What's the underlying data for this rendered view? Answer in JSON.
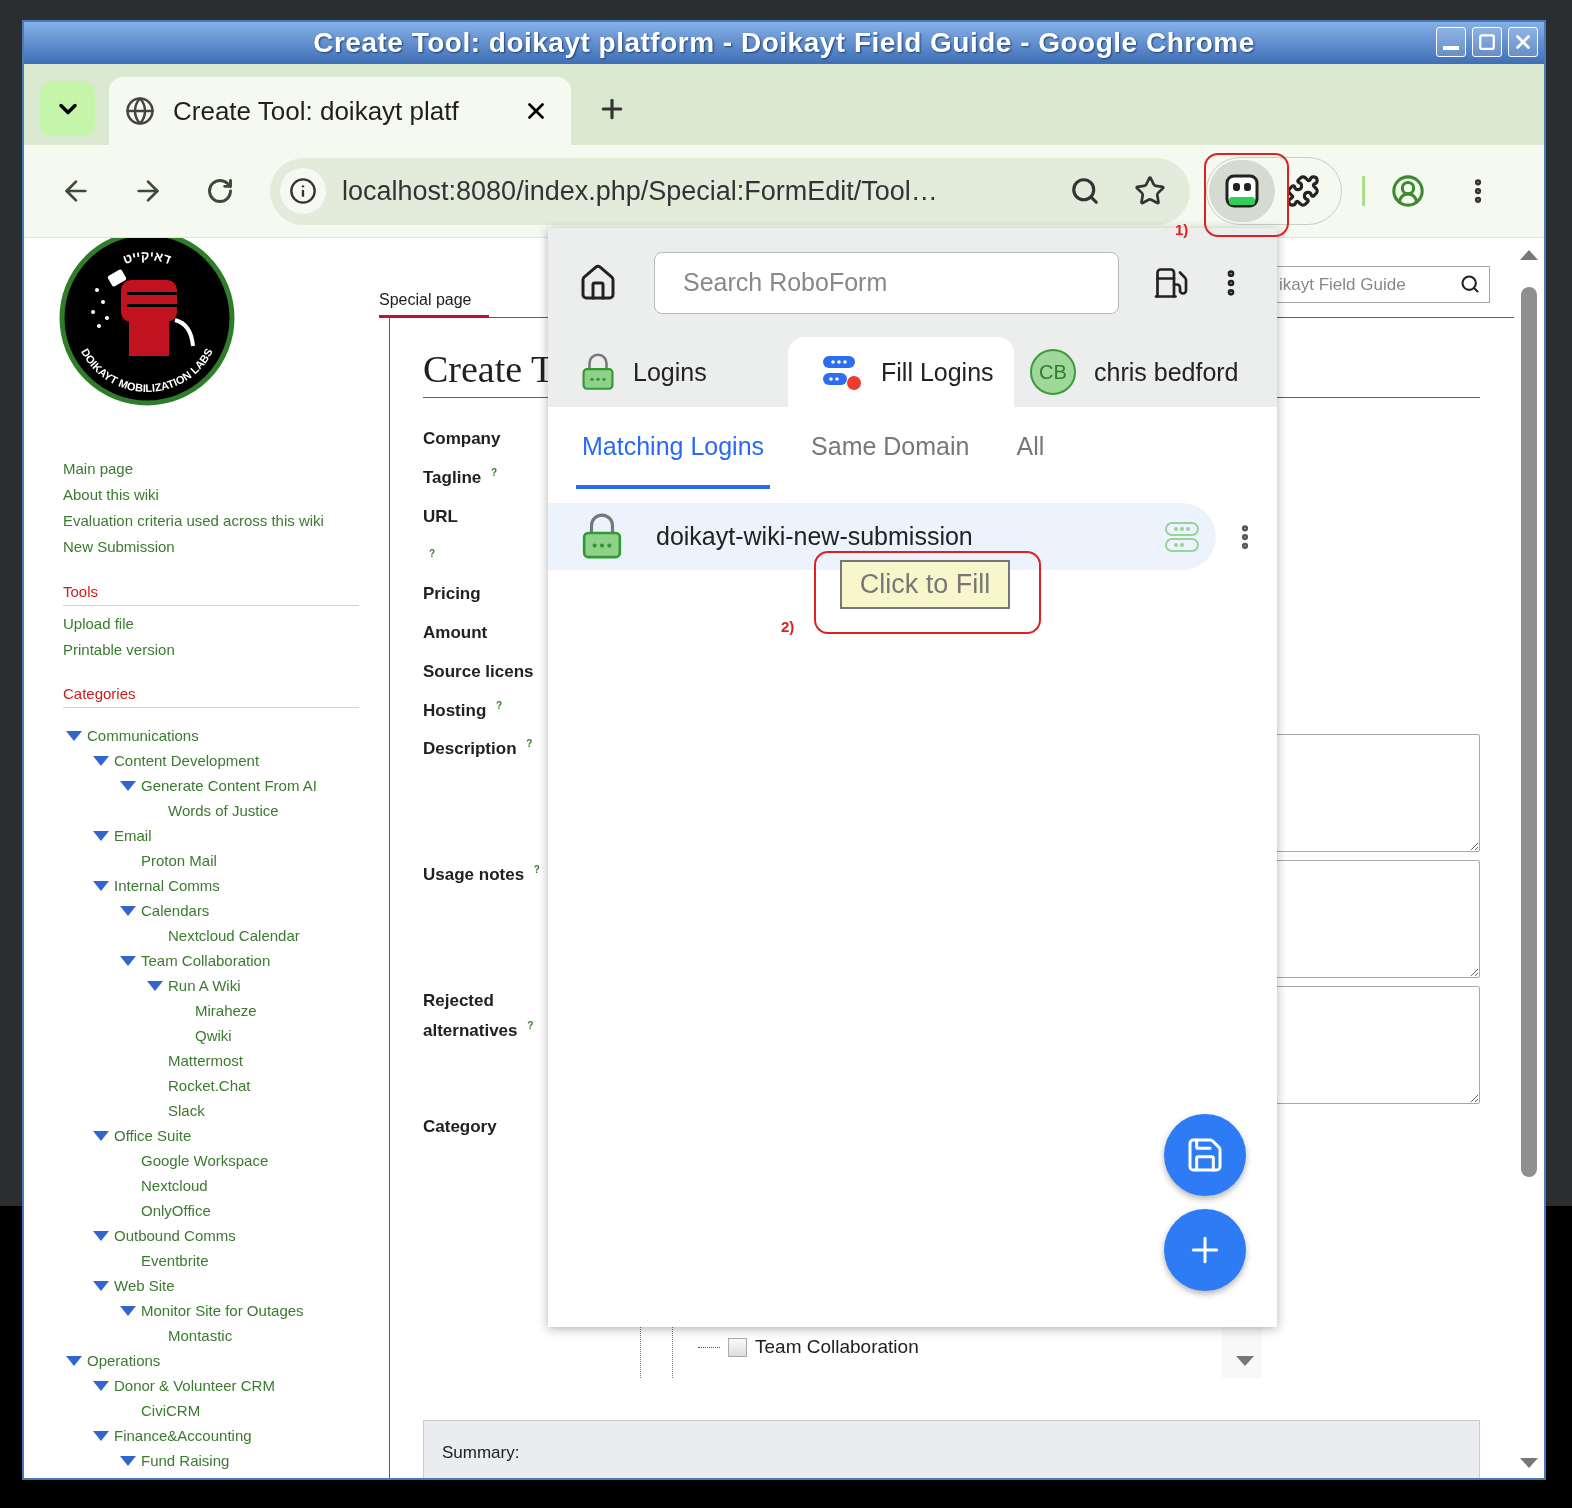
{
  "window": {
    "title": "Create Tool: doikayt platform - Doikayt Field Guide - Google Chrome"
  },
  "browser": {
    "tab_title": "Create Tool: doikayt platf",
    "address": "localhost:8080/index.php/Special:FormEdit/Tool…",
    "roboform_active": true
  },
  "sidebar": {
    "logo": {
      "top_text": "דאיקייט",
      "bottom_text": "DOIKAYT MOBILIZATION LABS"
    },
    "nav": [
      "Main page",
      "About this wiki",
      "Evaluation criteria used across this wiki",
      "New Submission"
    ],
    "tools": {
      "heading": "Tools",
      "items": [
        "Upload file",
        "Printable version"
      ]
    },
    "categories": {
      "heading": "Categories",
      "tree": [
        {
          "label": "Communications",
          "expanded": true,
          "children": [
            {
              "label": "Content Development",
              "expanded": true,
              "children": [
                {
                  "label": "Generate Content From AI",
                  "expanded": true,
                  "children": [
                    {
                      "label": "Words of Justice"
                    }
                  ]
                }
              ]
            },
            {
              "label": "Email",
              "expanded": true,
              "children": [
                {
                  "label": "Proton Mail"
                }
              ]
            },
            {
              "label": "Internal Comms",
              "expanded": true,
              "children": [
                {
                  "label": "Calendars",
                  "expanded": true,
                  "children": [
                    {
                      "label": "Nextcloud Calendar"
                    }
                  ]
                },
                {
                  "label": "Team Collaboration",
                  "expanded": true,
                  "children": [
                    {
                      "label": "Run A Wiki",
                      "expanded": true,
                      "children": [
                        {
                          "label": "Miraheze"
                        },
                        {
                          "label": "Qwiki"
                        }
                      ]
                    },
                    {
                      "label": "Mattermost"
                    },
                    {
                      "label": "Rocket.Chat"
                    },
                    {
                      "label": "Slack"
                    }
                  ]
                }
              ]
            },
            {
              "label": "Office Suite",
              "expanded": true,
              "children": [
                {
                  "label": "Google Workspace"
                },
                {
                  "label": "Nextcloud"
                },
                {
                  "label": "OnlyOffice"
                }
              ]
            },
            {
              "label": "Outbound Comms",
              "expanded": true,
              "children": [
                {
                  "label": "Eventbrite"
                }
              ]
            },
            {
              "label": "Web Site",
              "expanded": true,
              "children": [
                {
                  "label": "Monitor Site for Outages",
                  "expanded": true,
                  "children": [
                    {
                      "label": "Montastic"
                    }
                  ]
                }
              ]
            }
          ]
        },
        {
          "label": "Operations",
          "expanded": true,
          "children": [
            {
              "label": "Donor & Volunteer CRM",
              "expanded": true,
              "children": [
                {
                  "label": "CiviCRM"
                }
              ]
            },
            {
              "label": "Finance&Accounting",
              "expanded": true,
              "children": [
                {
                  "label": "Fund Raising",
                  "expanded": true
                }
              ]
            }
          ]
        }
      ]
    }
  },
  "page": {
    "tab": {
      "label": "Special page",
      "selected": true
    },
    "search": {
      "placeholder": "ikayt Field Guide"
    },
    "heading": "Create T",
    "fields": [
      {
        "label": "Company",
        "kind": "line"
      },
      {
        "label": "Tagline",
        "help": "?",
        "kind": "line"
      },
      {
        "label": "URL",
        "help": "?",
        "kind": "wrapped"
      },
      {
        "label": "Pricing",
        "kind": "line"
      },
      {
        "label": "Amount",
        "kind": "line"
      },
      {
        "label": "Source licens",
        "kind": "line"
      },
      {
        "label": "Hosting",
        "help": "?",
        "kind": "line"
      },
      {
        "label": "Description",
        "help": "?",
        "kind": "textarea"
      },
      {
        "label": "Usage notes",
        "help": "?",
        "kind": "textarea"
      },
      {
        "label": "Rejected alternatives",
        "help": "?",
        "kind": "textarea"
      },
      {
        "label": "Category",
        "kind": "tree"
      }
    ],
    "category_tree": [
      {
        "label": "Team Collaboration",
        "checked": false
      }
    ],
    "summary_label": "Summary:"
  },
  "roboform": {
    "search": {
      "placeholder": "Search RoboForm"
    },
    "tabs": [
      {
        "label": "Logins",
        "kind": "logins",
        "selected": false
      },
      {
        "label": "Fill Logins",
        "kind": "fill",
        "selected": true
      },
      {
        "label": "chris bedford",
        "kind": "account",
        "initials": "CB",
        "selected": false
      }
    ],
    "subtabs": [
      {
        "label": "Matching Logins",
        "selected": true
      },
      {
        "label": "Same Domain",
        "selected": false
      },
      {
        "label": "All",
        "selected": false
      }
    ],
    "logins": [
      {
        "name": "doikayt-wiki-new-submission",
        "hovered": true
      }
    ],
    "tooltip": "Click to Fill"
  },
  "annotations": [
    {
      "label": "1)"
    },
    {
      "label": "2)"
    }
  ]
}
